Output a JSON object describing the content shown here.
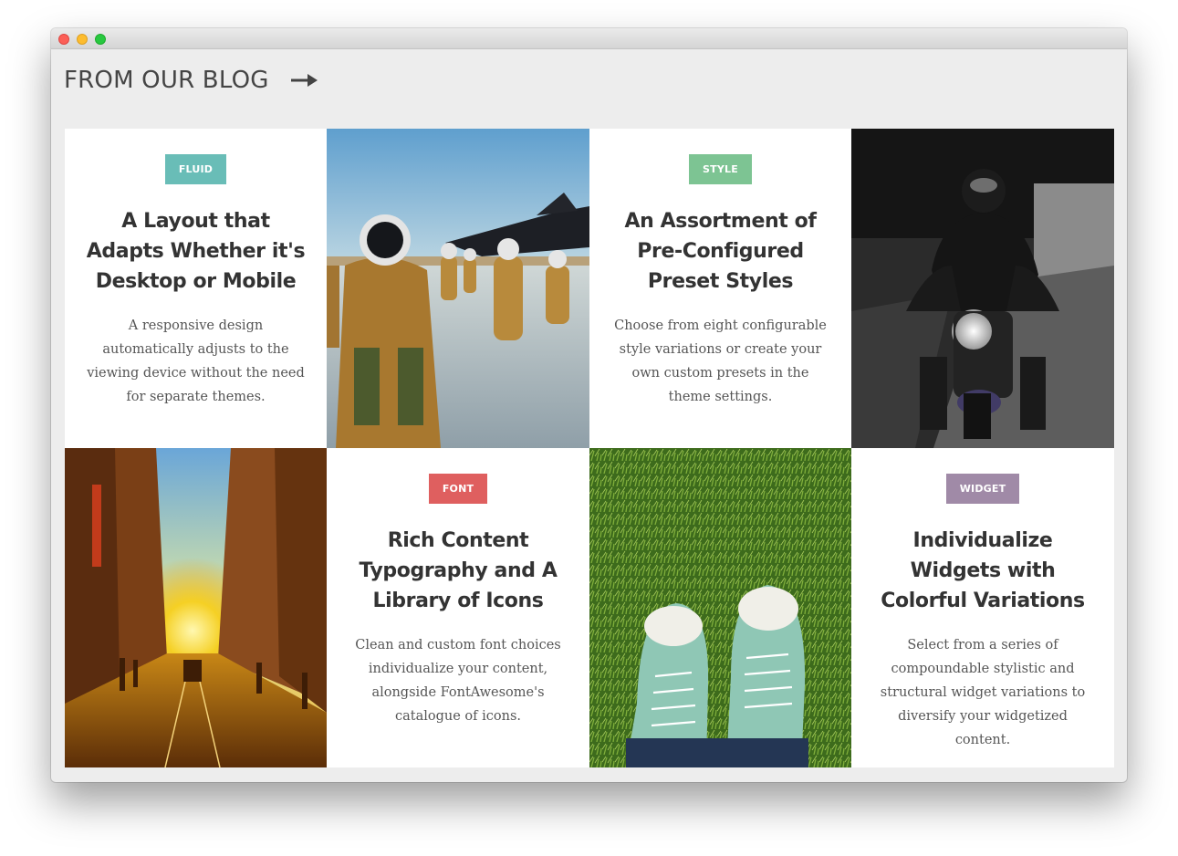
{
  "section": {
    "title": "FROM OUR BLOG",
    "arrow_icon": "arrow-right-icon"
  },
  "posts": [
    {
      "tag": "FLUID",
      "tag_color": "#69bdb7",
      "title": "A Layout that Adapts Whether it's Desktop or Mobile",
      "body": "A responsive design automatically adjusts to the viewing device without the need for separate themes."
    },
    {
      "tag": "STYLE",
      "tag_color": "#7dc493",
      "title": "An Assortment of Pre-Configured Preset Styles",
      "body": "Choose from eight configurable style variations or create your own custom presets in the theme settings."
    },
    {
      "tag": "FONT",
      "tag_color": "#df5f5f",
      "title": "Rich Content Typography and A Library of Icons",
      "body": "Clean and custom font choices individualize your content, alongside FontAwesome's catalogue of icons."
    },
    {
      "tag": "WIDGET",
      "tag_color": "#a08aa7",
      "title": "Individualize Widgets with Colorful Variations",
      "body": "Select from a series of compoundable stylistic and structural widget variations to diversify your widgetized content."
    }
  ]
}
